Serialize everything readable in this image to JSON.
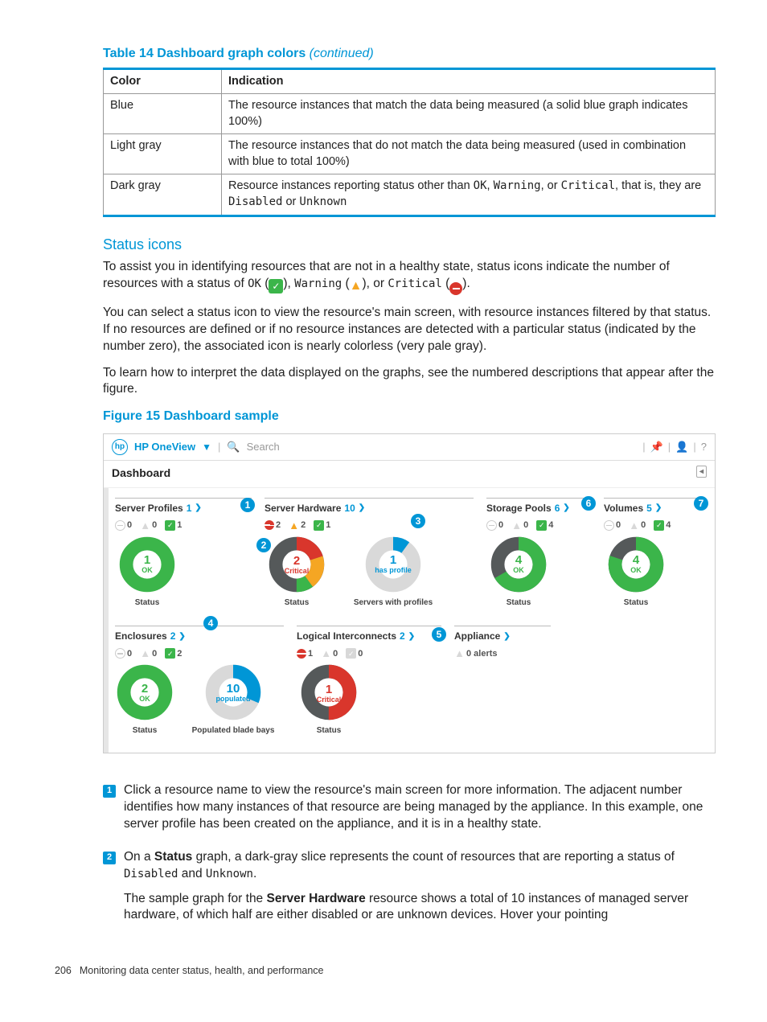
{
  "table": {
    "caption_prefix": "Table 14 Dashboard graph colors",
    "caption_suffix": "(continued)",
    "head_color": "Color",
    "head_ind": "Indication",
    "rows": [
      {
        "color": "Blue",
        "ind": "The resource instances that match the data being measured (a solid blue graph indicates 100%)"
      },
      {
        "color": "Light gray",
        "ind": "The resource instances that do not match the data being measured (used in combination with blue to total 100%)"
      },
      {
        "color": "Dark gray",
        "ind_pre": "Resource instances reporting status other than ",
        "ok": "OK",
        "c1": ", ",
        "warn": "Warning",
        "c2": ", or ",
        "crit": "Critical",
        "mid": ", that is, they are ",
        "dis": "Disabled",
        "or": " or ",
        "unk": "Unknown"
      }
    ]
  },
  "status_heading": "Status icons",
  "para1_a": "To assist you in identifying resources that are not in a healthy state, status icons indicate the number of resources with a status of ",
  "s_ok": "OK",
  " s_op": " (",
  "s_warn": "Warning",
  "s_crit": "Critical",
  "s_cp": ").",
  "para2": "You can select a status icon to view the resource's main screen, with resource instances filtered by that status. If no resources are defined or if no resource instances are detected with a particular status (indicated by the number zero), the associated icon is nearly colorless (very pale gray).",
  "para3": "To learn how to interpret the data displayed on the graphs, see the numbered descriptions that appear after the figure.",
  "figure_caption": "Figure 15 Dashboard sample",
  "ui": {
    "brand": "HP OneView",
    "search": "Search",
    "dash": "Dashboard",
    "panel_badge": "◂",
    "cards": {
      "server_profiles": {
        "title": "Server Profiles",
        "count": "1",
        "unk": "0",
        "warn": "0",
        "ok": "1",
        "center_n": "1",
        "center_l": "OK",
        "cap": "Status"
      },
      "server_hw": {
        "title": "Server Hardware",
        "count": "10",
        "crit": "2",
        "warn": "2",
        "ok": "1",
        "center_n": "2",
        "center_l": "Critical",
        "cap1": "Status",
        "center2_n": "1",
        "center2_l": "has profile",
        "cap2": "Servers with profiles"
      },
      "storage_pools": {
        "title": "Storage Pools",
        "count": "6",
        "unk": "0",
        "warn": "0",
        "ok": "4",
        "center_n": "4",
        "center_l": "OK",
        "cap": "Status"
      },
      "volumes": {
        "title": "Volumes",
        "count": "5",
        "unk": "0",
        "warn": "0",
        "ok": "4",
        "center_n": "4",
        "center_l": "OK",
        "cap": "Status"
      },
      "enclosures": {
        "title": "Enclosures",
        "count": "2",
        "unk": "0",
        "warn": "0",
        "ok": "2",
        "center_n": "2",
        "center_l": "OK",
        "cap1": "Status",
        "center2_n": "10",
        "center2_l": "populated",
        "cap2": "Populated blade bays"
      },
      "logical": {
        "title": "Logical Interconnects",
        "count": "2",
        "crit": "1",
        "warn": "0",
        "ok": "0",
        "center_n": "1",
        "center_l": "Critical",
        "cap": "Status"
      },
      "appliance": {
        "title": "Appliance",
        "alerts": "0 alerts"
      }
    }
  },
  "notes": {
    "n1": "Click a resource name to view the resource's main screen for more information. The adjacent number identifies how many instances of that resource are being managed by the appliance. In this example, one server profile has been created on the appliance, and it is in a healthy state.",
    "n2_a": "On a ",
    "n2_status": "Status",
    "n2_b": " graph, a dark-gray slice represents the count of resources that are reporting a status of ",
    "n2_dis": "Disabled",
    "n2_and": " and ",
    "n2_unk": "Unknown",
    "n2_c": ".",
    "n2_p2_a": "The sample graph for the ",
    "n2_sh": "Server Hardware",
    "n2_p2_b": " resource shows a total of 10 instances of managed server hardware, of which half are either disabled or are unknown devices. Hover your pointing"
  },
  "footer": {
    "page": "206",
    "chap": "Monitoring data center status, health, and performance"
  }
}
